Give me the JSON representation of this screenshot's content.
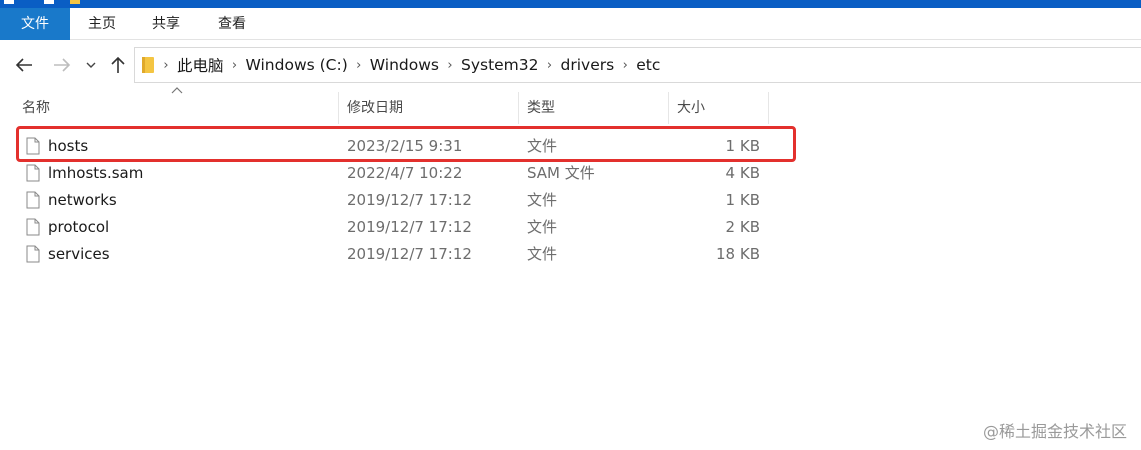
{
  "ribbon": {
    "tabs": [
      {
        "label": "文件"
      },
      {
        "label": "主页"
      },
      {
        "label": "共享"
      },
      {
        "label": "查看"
      }
    ]
  },
  "nav": {
    "back_icon": "arrow-left-icon",
    "forward_icon": "arrow-right-icon",
    "recent_icon": "chevron-down-icon",
    "up_icon": "arrow-up-icon"
  },
  "address": {
    "crumbs": [
      "此电脑",
      "Windows (C:)",
      "Windows",
      "System32",
      "drivers",
      "etc"
    ]
  },
  "columns": {
    "name": "名称",
    "date": "修改日期",
    "type": "类型",
    "size": "大小"
  },
  "files": [
    {
      "name": "hosts",
      "date": "2023/2/15 9:31",
      "type": "文件",
      "size": "1 KB"
    },
    {
      "name": "lmhosts.sam",
      "date": "2022/4/7 10:22",
      "type": "SAM 文件",
      "size": "4 KB"
    },
    {
      "name": "networks",
      "date": "2019/12/7 17:12",
      "type": "文件",
      "size": "1 KB"
    },
    {
      "name": "protocol",
      "date": "2019/12/7 17:12",
      "type": "文件",
      "size": "2 KB"
    },
    {
      "name": "services",
      "date": "2019/12/7 17:12",
      "type": "文件",
      "size": "18 KB"
    }
  ],
  "watermark": "@稀土掘金技术社区",
  "colors": {
    "accent": "#1979ca",
    "highlight": "#e3302d",
    "folder": "#f4c542"
  }
}
